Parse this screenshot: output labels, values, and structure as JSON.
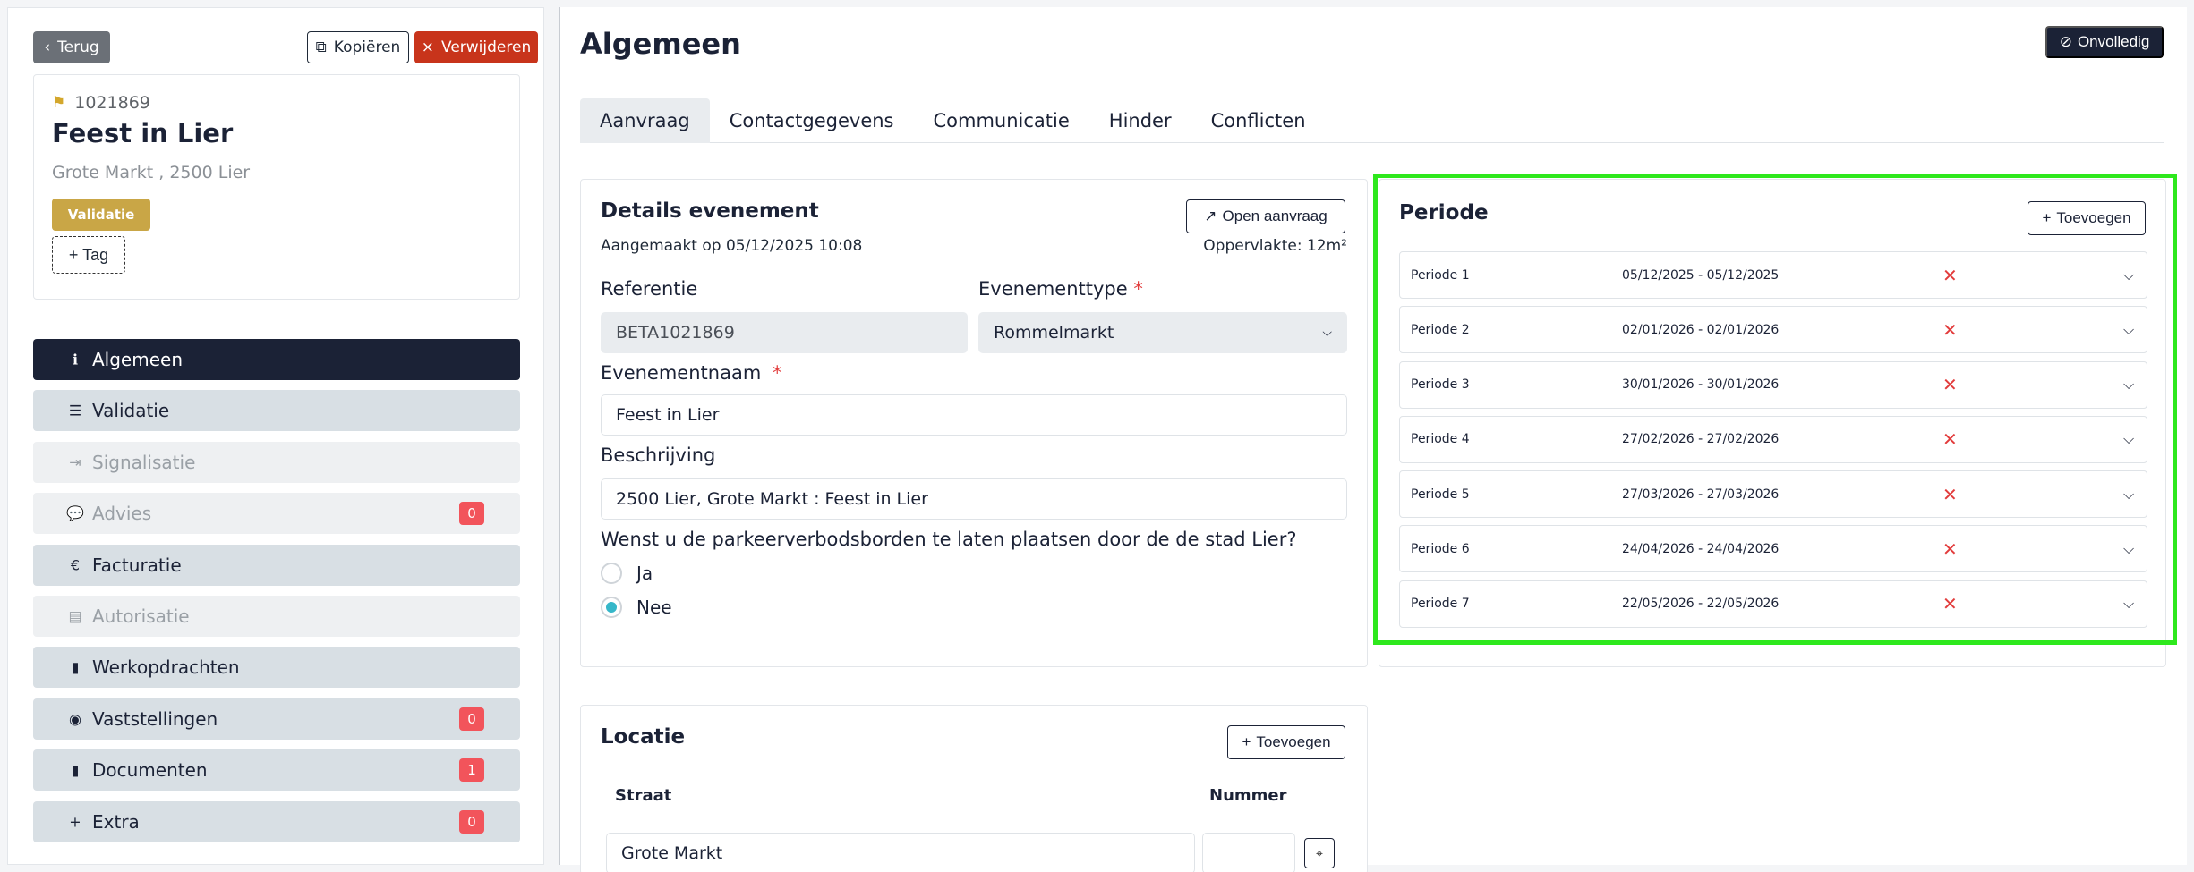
{
  "header": {
    "back_label": "Terug",
    "copy_label": "Kopiëren",
    "delete_label": "Verwijderen"
  },
  "event": {
    "id": "1021869",
    "name": "Feest in Lier",
    "address": "Grote Markt , 2500 Lier",
    "status_badge": "Validatie",
    "tag_button": "+ Tag"
  },
  "sidebar": {
    "items": [
      {
        "label": "Algemeen",
        "icon": "info-icon",
        "state": "active",
        "count": null
      },
      {
        "label": "Validatie",
        "icon": "checklist-icon",
        "state": "normal",
        "count": null
      },
      {
        "label": "Signalisatie",
        "icon": "signpost-icon",
        "state": "muted",
        "count": null
      },
      {
        "label": "Advies",
        "icon": "comment-icon",
        "state": "muted",
        "count": "0"
      },
      {
        "label": "Facturatie",
        "icon": "euro-icon",
        "state": "normal",
        "count": null
      },
      {
        "label": "Autorisatie",
        "icon": "file-lock-icon",
        "state": "muted",
        "count": null
      },
      {
        "label": "Werkopdrachten",
        "icon": "file-icon",
        "state": "normal",
        "count": null
      },
      {
        "label": "Vaststellingen",
        "icon": "eye-icon",
        "state": "normal",
        "count": "0"
      },
      {
        "label": "Documenten",
        "icon": "document-icon",
        "state": "normal",
        "count": "1"
      },
      {
        "label": "Extra",
        "icon": "plus-icon",
        "state": "normal",
        "count": "0"
      }
    ]
  },
  "main": {
    "title": "Algemeen",
    "status_button": "Onvolledig",
    "tabs": [
      {
        "label": "Aanvraag",
        "active": true
      },
      {
        "label": "Contactgegevens",
        "active": false
      },
      {
        "label": "Communicatie",
        "active": false
      },
      {
        "label": "Hinder",
        "active": false
      },
      {
        "label": "Conflicten",
        "active": false
      }
    ]
  },
  "details": {
    "title": "Details evenement",
    "open_button": "Open aanvraag",
    "created": "Aangemaakt op 05/12/2025 10:08",
    "area": "Oppervlakte: 12m²",
    "referentie_label": "Referentie",
    "referentie_value": "BETA1021869",
    "type_label": "Evenementtype",
    "type_value": "Rommelmarkt",
    "name_label": "Evenementnaam",
    "name_value": "Feest in Lier",
    "desc_label": "Beschrijving",
    "desc_value": "2500 Lier, Grote Markt : Feest in Lier",
    "question": "Wenst u de parkeerverbodsborden te laten plaatsen door de de stad Lier?",
    "option_yes": "Ja",
    "option_no": "Nee",
    "selected": "Nee",
    "required_mark": "*"
  },
  "periode": {
    "title": "Periode",
    "add_button": "Toevoegen",
    "rows": [
      {
        "name": "Periode 1",
        "dates": "05/12/2025 - 05/12/2025"
      },
      {
        "name": "Periode 2",
        "dates": "02/01/2026 - 02/01/2026"
      },
      {
        "name": "Periode 3",
        "dates": "30/01/2026 - 30/01/2026"
      },
      {
        "name": "Periode 4",
        "dates": "27/02/2026 - 27/02/2026"
      },
      {
        "name": "Periode 5",
        "dates": "27/03/2026 - 27/03/2026"
      },
      {
        "name": "Periode 6",
        "dates": "24/04/2026 - 24/04/2026"
      },
      {
        "name": "Periode 7",
        "dates": "22/05/2026 - 22/05/2026"
      }
    ]
  },
  "locatie": {
    "title": "Locatie",
    "add_button": "Toevoegen",
    "col_street": "Straat",
    "col_number": "Nummer",
    "street_value": "Grote Markt",
    "number_value": ""
  },
  "colors": {
    "navy": "#1b2236",
    "danger": "#c8341b",
    "badge_gold": "#c9a646",
    "highlight_green": "#2ee81d",
    "radio_accent": "#36b7c9",
    "count_red": "#f2545b"
  }
}
